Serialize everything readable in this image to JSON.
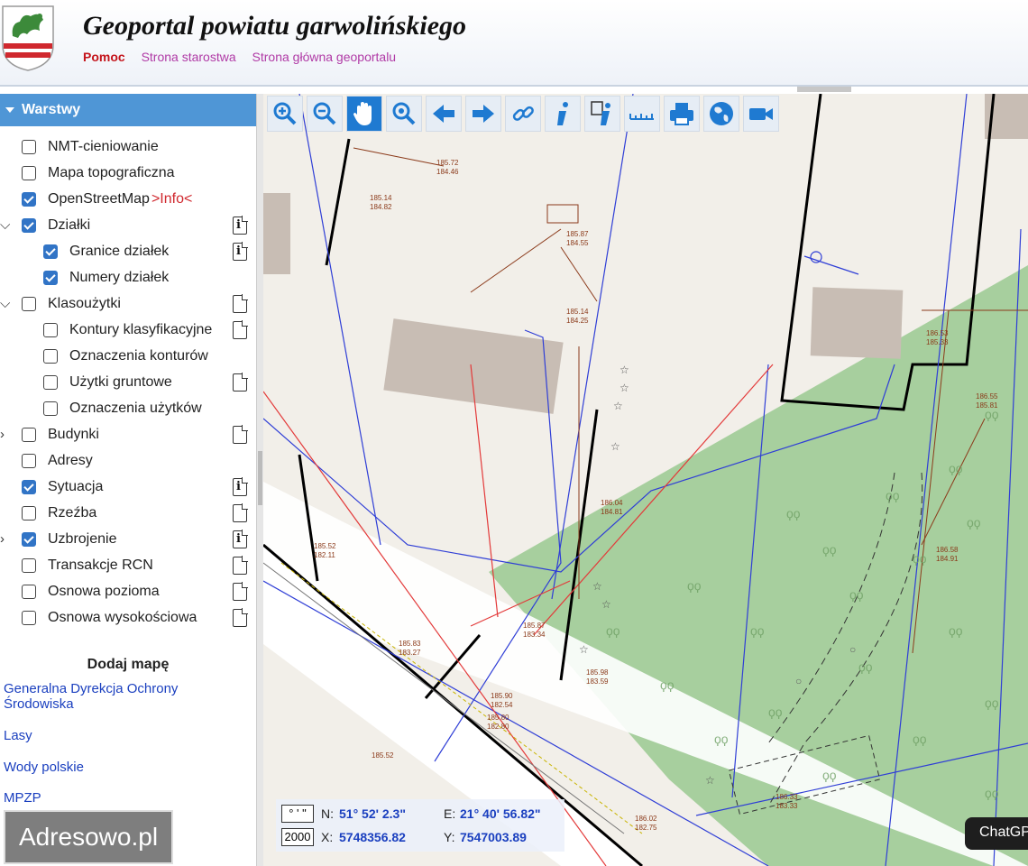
{
  "header": {
    "title": "Geoportal powiatu garwolińskiego",
    "nav": [
      "Pomoc",
      "Strona starostwa",
      "Strona główna geoportalu"
    ]
  },
  "sidebar": {
    "panel_title": "Warstwy",
    "layers": [
      {
        "label": "NMT-cieniowanie",
        "checked": false
      },
      {
        "label": "Mapa topograficzna",
        "checked": false
      },
      {
        "label": "OpenStreetMap",
        "checked": true,
        "info_link": ">Info<"
      },
      {
        "label": "Działki",
        "checked": true
      },
      {
        "label": "Granice działek",
        "checked": true
      },
      {
        "label": "Numery działek",
        "checked": true
      },
      {
        "label": "Klasoużytki",
        "checked": false
      },
      {
        "label": "Kontury klasyfikacyjne",
        "checked": false
      },
      {
        "label": "Oznaczenia konturów",
        "checked": false
      },
      {
        "label": "Użytki gruntowe",
        "checked": false
      },
      {
        "label": "Oznaczenia użytków",
        "checked": false
      },
      {
        "label": "Budynki",
        "checked": false
      },
      {
        "label": "Adresy",
        "checked": false
      },
      {
        "label": "Sytuacja",
        "checked": true
      },
      {
        "label": "Rzeźba",
        "checked": false
      },
      {
        "label": "Uzbrojenie",
        "checked": true
      },
      {
        "label": "Transakcje RCN",
        "checked": false
      },
      {
        "label": "Osnowa pozioma",
        "checked": false
      },
      {
        "label": "Osnowa wysokościowa",
        "checked": false
      }
    ],
    "add_map_title": "Dodaj mapę",
    "map_links": [
      "Generalna Dyrekcja Ochrony Środowiska",
      "Lasy",
      "Wody polskie",
      "MPZP"
    ]
  },
  "toolbar": {
    "tools": [
      "zoom-in-icon",
      "zoom-out-icon",
      "pan-hand-icon",
      "zoom-extent-icon",
      "back-arrow-icon",
      "forward-arrow-icon",
      "link-icon",
      "info-icon",
      "info-area-icon",
      "measure-ruler-icon",
      "print-icon",
      "globe-icon",
      "camera-icon"
    ]
  },
  "coords": {
    "deg_button": "° ' \"",
    "scale_value": "2000",
    "n_label": "N:",
    "n_value": "51° 52' 2.3\"",
    "e_label": "E:",
    "e_value": "21° 40' 56.82\"",
    "x_label": "X:",
    "x_value": "5748356.82",
    "y_label": "Y:",
    "y_value": "7547003.89"
  },
  "watermark": "Adresowo.pl",
  "chat_badge": "ChatGPT",
  "map_labels": {
    "a": "185.72",
    "a2": "184.46",
    "b": "185.14",
    "b2": "184.82",
    "c": "185.87",
    "c2": "184.55",
    "d": "185.14",
    "d2": "184.25",
    "e": "186.53",
    "e2": "185.33",
    "f": "186.55",
    "f2": "185.81",
    "g": "186.04",
    "g2": "184.81",
    "h": "185.52",
    "h2": "182.11",
    "i": "186.58",
    "i2": "184.91",
    "j": "185.87",
    "j2": "183.34",
    "k": "185.98",
    "k2": "183.59",
    "l": "185.83",
    "l2": "183.27",
    "m": "185.90",
    "m2": "182.54",
    "n": "185.80",
    "n2": "182.80",
    "o": "185.52",
    "p": "186.33",
    "p2": "183.33",
    "q": "186.02",
    "q2": "182.75"
  },
  "colors": {
    "panel": "#4f96d6",
    "forest": "#a7cf9e",
    "link": "#1a3fbf",
    "nav_active": "#c4141b"
  }
}
